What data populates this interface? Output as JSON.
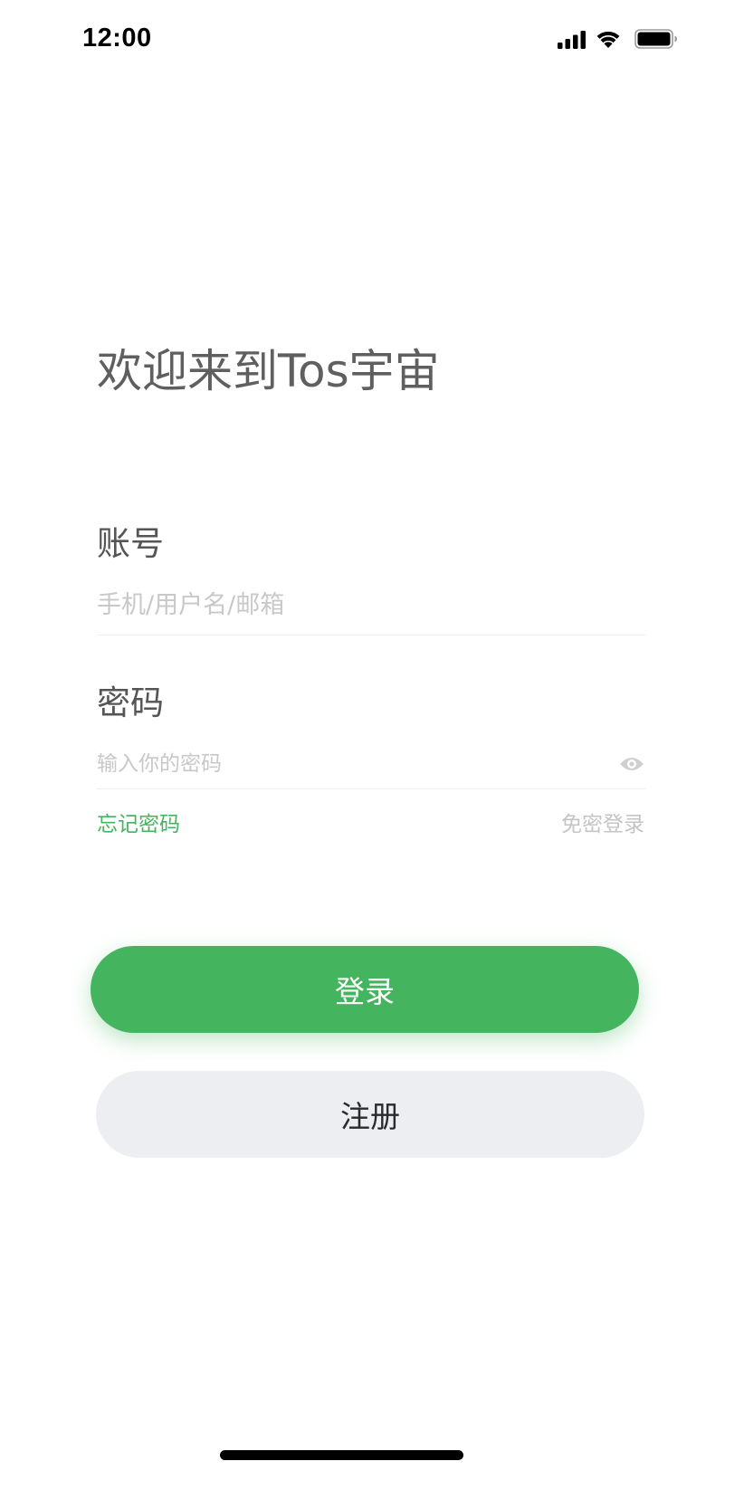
{
  "status_bar": {
    "time": "12:00",
    "icons": [
      "signal-icon",
      "wifi-icon",
      "battery-icon"
    ]
  },
  "welcome": {
    "title": "欢迎来到Tos宇宙"
  },
  "account": {
    "label": "账号",
    "value": "",
    "placeholder": "手机/用户名/邮箱"
  },
  "password": {
    "label": "密码",
    "value": "",
    "placeholder": "输入你的密码",
    "visibility_icon": "eye-icon"
  },
  "links": {
    "forgot_password": "忘记密码",
    "passwordless_login": "免密登录"
  },
  "actions": {
    "login": "登录",
    "register": "注册"
  },
  "colors": {
    "accent": "#45b45e",
    "secondary_button_bg": "#eceef2",
    "placeholder": "#c8c8c8",
    "title_text": "#5f5f5f"
  }
}
